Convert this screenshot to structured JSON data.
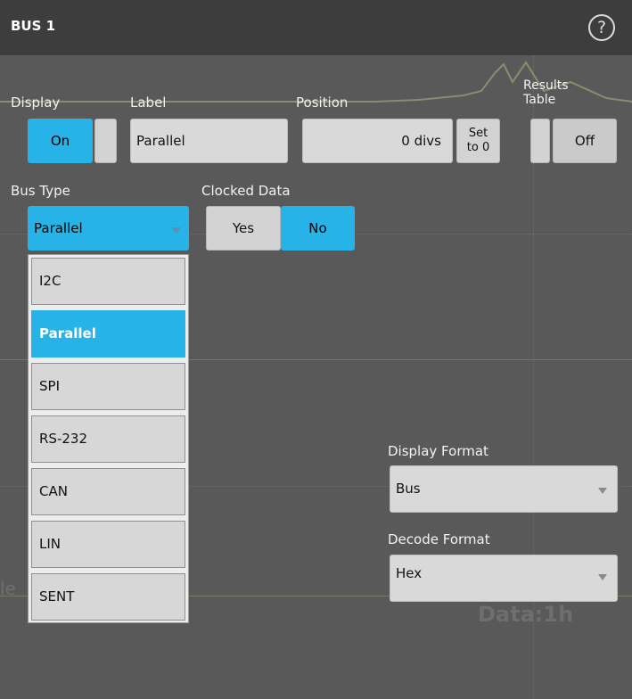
{
  "window": {
    "title": "BUS 1",
    "help_glyph": "?"
  },
  "colors": {
    "accent": "#27b2e8",
    "panel": "#595959",
    "titlebar": "#3d3d3d"
  },
  "display": {
    "label": "Display",
    "value": "On"
  },
  "label_field": {
    "label": "Label",
    "value": "Parallel"
  },
  "position": {
    "label": "Position",
    "value": "0 divs",
    "set_button": [
      "Set",
      "to 0"
    ]
  },
  "results_table": {
    "label": "Results\nTable",
    "value": "Off"
  },
  "bus_type": {
    "label": "Bus Type",
    "selected": "Parallel",
    "options": [
      "I2C",
      "Parallel",
      "SPI",
      "RS-232",
      "CAN",
      "LIN",
      "SENT"
    ]
  },
  "clocked_data": {
    "label": "Clocked Data",
    "options": [
      "Yes",
      "No"
    ],
    "selected": "No"
  },
  "display_format": {
    "label": "Display Format",
    "value": "Bus"
  },
  "decode_format": {
    "label": "Decode Format",
    "value": "Hex"
  },
  "background_text": {
    "data_readout": "Data:1h",
    "left_fragment": "le"
  }
}
